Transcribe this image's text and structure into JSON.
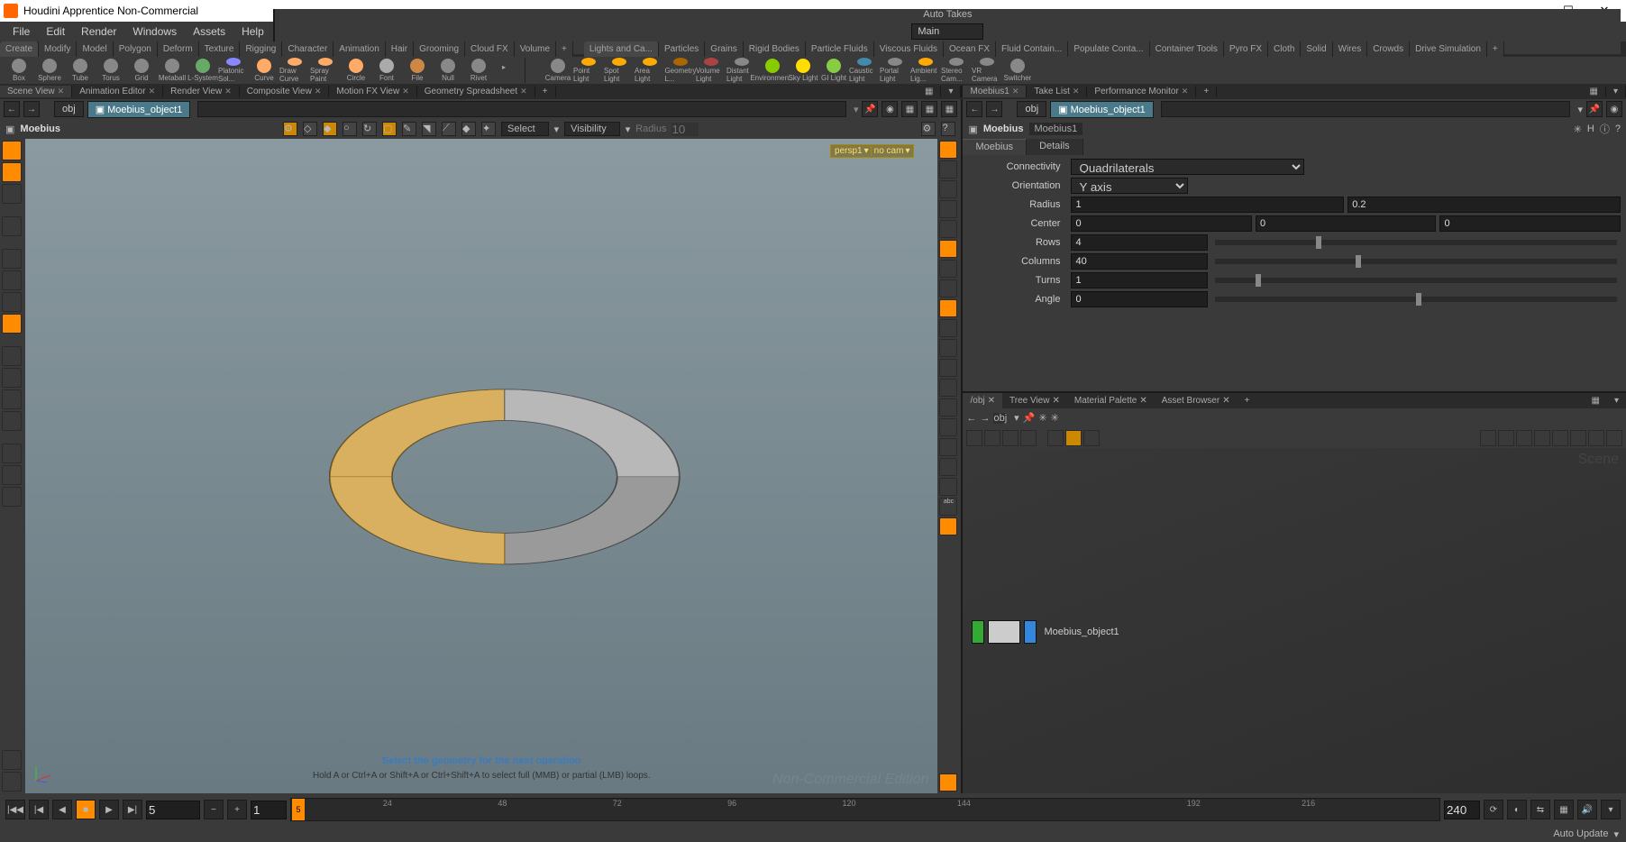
{
  "window": {
    "title": "Houdini Apprentice Non-Commercial"
  },
  "menubar": {
    "items": [
      "File",
      "Edit",
      "Render",
      "Windows",
      "Assets",
      "Help"
    ],
    "auto_takes": "Auto Takes",
    "main": "Main"
  },
  "shelf_tabs_left": [
    "Create",
    "Modify",
    "Model",
    "Polygon",
    "Deform",
    "Texture",
    "Rigging",
    "Character",
    "Animation",
    "Hair",
    "Grooming",
    "Cloud FX",
    "Volume"
  ],
  "shelf_tabs_right": [
    "Lights and Ca...",
    "Particles",
    "Grains",
    "Rigid Bodies",
    "Particle Fluids",
    "Viscous Fluids",
    "Ocean FX",
    "Fluid Contain...",
    "Populate Conta...",
    "Container Tools",
    "Pyro FX",
    "Cloth",
    "Solid",
    "Wires",
    "Crowds",
    "Drive Simulation"
  ],
  "shelf_tools_left": [
    {
      "label": "Box",
      "color": "#888"
    },
    {
      "label": "Sphere",
      "color": "#888"
    },
    {
      "label": "Tube",
      "color": "#888"
    },
    {
      "label": "Torus",
      "color": "#888"
    },
    {
      "label": "Grid",
      "color": "#888"
    },
    {
      "label": "Metaball",
      "color": "#888"
    },
    {
      "label": "L-System",
      "color": "#6a6"
    },
    {
      "label": "Platonic Sol...",
      "color": "#88f"
    },
    {
      "label": "Curve",
      "color": "#fa6"
    },
    {
      "label": "Draw Curve",
      "color": "#fa6"
    },
    {
      "label": "Spray Paint",
      "color": "#fa6"
    },
    {
      "label": "Circle",
      "color": "#fa6"
    },
    {
      "label": "Font",
      "color": "#aaa"
    },
    {
      "label": "File",
      "color": "#c84"
    },
    {
      "label": "Null",
      "color": "#888"
    },
    {
      "label": "Rivet",
      "color": "#888"
    }
  ],
  "shelf_tools_right": [
    {
      "label": "Camera",
      "color": "#888"
    },
    {
      "label": "Point Light",
      "color": "#fa0"
    },
    {
      "label": "Spot Light",
      "color": "#fa0"
    },
    {
      "label": "Area Light",
      "color": "#fa0"
    },
    {
      "label": "Geometry L...",
      "color": "#a60"
    },
    {
      "label": "Volume Light",
      "color": "#a44"
    },
    {
      "label": "Distant Light",
      "color": "#888"
    },
    {
      "label": "Environmen...",
      "color": "#8c0"
    },
    {
      "label": "Sky Light",
      "color": "#fd0"
    },
    {
      "label": "GI Light",
      "color": "#8c4"
    },
    {
      "label": "Caustic Light",
      "color": "#48a"
    },
    {
      "label": "Portal Light",
      "color": "#888"
    },
    {
      "label": "Ambient Lig...",
      "color": "#fa0"
    },
    {
      "label": "Stereo Cam...",
      "color": "#888"
    },
    {
      "label": "VR Camera",
      "color": "#888"
    },
    {
      "label": "Switcher",
      "color": "#888"
    }
  ],
  "view_tabs": [
    "Scene View",
    "Animation Editor",
    "Render View",
    "Composite View",
    "Motion FX View",
    "Geometry Spreadsheet"
  ],
  "right_top_tabs": [
    "Moebius1",
    "Take List",
    "Performance Monitor"
  ],
  "path_left": {
    "level": "obj",
    "node": "Moebius_object1"
  },
  "path_right": {
    "level": "obj",
    "node": "Moebius_object1"
  },
  "view": {
    "operator": "Moebius",
    "select_label": "Select",
    "visibility_label": "Visibility",
    "radius_label": "Radius",
    "radius_placeholder": "10",
    "persp": "persp1",
    "cam": "no cam",
    "hint1": "Select the geometry for the next operation",
    "hint2": "Hold A or Ctrl+A or Shift+A or Ctrl+Shift+A to select full (MMB) or partial (LMB) loops.",
    "watermark": "Non-Commercial Edition"
  },
  "parameters": {
    "operator": "Moebius",
    "name2": "Moebius1",
    "tabs": [
      "Moebius",
      "Details"
    ],
    "connectivity_label": "Connectivity",
    "connectivity": "Quadrilaterals",
    "orientation_label": "Orientation",
    "orientation": "Y axis",
    "radius_label": "Radius",
    "radius_a": "1",
    "radius_b": "0.2",
    "center_label": "Center",
    "center_x": "0",
    "center_y": "0",
    "center_z": "0",
    "rows_label": "Rows",
    "rows": "4",
    "columns_label": "Columns",
    "columns": "40",
    "turns_label": "Turns",
    "turns": "1",
    "angle_label": "Angle",
    "angle": "0"
  },
  "network": {
    "tabs": [
      "/obj",
      "Tree View",
      "Material Palette",
      "Asset Browser"
    ],
    "path_level": "obj",
    "scene_label": "Scene",
    "node_name": "Moebius_object1"
  },
  "timeline": {
    "start": "1",
    "frame": "5",
    "end": "240",
    "ticks": [
      "24",
      "48",
      "72",
      "96",
      "120",
      "144",
      "192",
      "216"
    ],
    "cursor": "5"
  },
  "status": {
    "auto_update": "Auto Update"
  }
}
